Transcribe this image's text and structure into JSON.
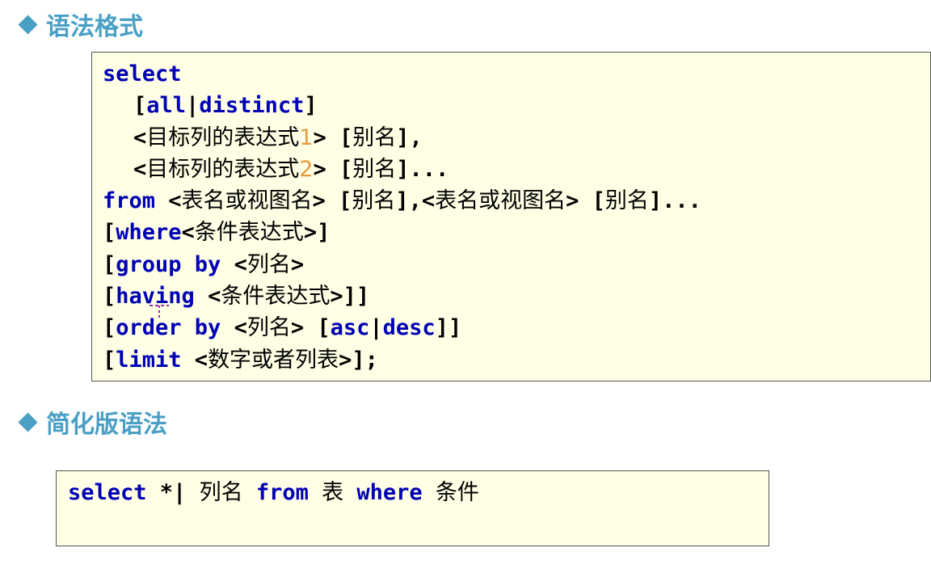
{
  "section1": {
    "title": "语法格式",
    "lines": [
      {
        "indent": false,
        "parts": [
          {
            "t": "k",
            "v": "select"
          }
        ]
      },
      {
        "indent": true,
        "parts": [
          {
            "t": "s",
            "v": "["
          },
          {
            "t": "k",
            "v": "all"
          },
          {
            "t": "s",
            "v": "|"
          },
          {
            "t": "k",
            "v": "distinct"
          },
          {
            "t": "s",
            "v": "]"
          }
        ]
      },
      {
        "indent": true,
        "parts": [
          {
            "t": "s",
            "v": "<"
          },
          {
            "t": "c",
            "v": "目标列的表达式"
          },
          {
            "t": "n",
            "v": "1"
          },
          {
            "t": "s",
            "v": "> ["
          },
          {
            "t": "c",
            "v": "别名"
          },
          {
            "t": "s",
            "v": "],"
          }
        ]
      },
      {
        "indent": true,
        "parts": [
          {
            "t": "s",
            "v": "<"
          },
          {
            "t": "c",
            "v": "目标列的表达式"
          },
          {
            "t": "n",
            "v": "2"
          },
          {
            "t": "s",
            "v": "> ["
          },
          {
            "t": "c",
            "v": "别名"
          },
          {
            "t": "s",
            "v": "]..."
          }
        ]
      },
      {
        "indent": false,
        "parts": [
          {
            "t": "k",
            "v": "from"
          },
          {
            "t": "s",
            "v": " <"
          },
          {
            "t": "c",
            "v": "表名或视图名"
          },
          {
            "t": "s",
            "v": "> ["
          },
          {
            "t": "c",
            "v": "别名"
          },
          {
            "t": "s",
            "v": "],<"
          },
          {
            "t": "c",
            "v": "表名或视图名"
          },
          {
            "t": "s",
            "v": "> ["
          },
          {
            "t": "c",
            "v": "别名"
          },
          {
            "t": "s",
            "v": "]..."
          }
        ]
      },
      {
        "indent": false,
        "parts": [
          {
            "t": "s",
            "v": "["
          },
          {
            "t": "k",
            "v": "where"
          },
          {
            "t": "s",
            "v": "<"
          },
          {
            "t": "c",
            "v": "条件表达式"
          },
          {
            "t": "s",
            "v": ">]"
          }
        ]
      },
      {
        "indent": false,
        "parts": [
          {
            "t": "s",
            "v": "["
          },
          {
            "t": "k",
            "v": "group by"
          },
          {
            "t": "s",
            "v": " <"
          },
          {
            "t": "c",
            "v": "列名"
          },
          {
            "t": "s",
            "v": ">"
          }
        ]
      },
      {
        "indent": false,
        "parts": [
          {
            "t": "s",
            "v": "["
          },
          {
            "t": "k",
            "v": "having"
          },
          {
            "t": "s",
            "v": " <"
          },
          {
            "t": "c",
            "v": "条件表达式"
          },
          {
            "t": "s",
            "v": ">]]"
          }
        ]
      },
      {
        "indent": false,
        "parts": [
          {
            "t": "s",
            "v": "["
          },
          {
            "t": "k",
            "v": "order by"
          },
          {
            "t": "s",
            "v": " <"
          },
          {
            "t": "c",
            "v": "列名"
          },
          {
            "t": "s",
            "v": "> ["
          },
          {
            "t": "k",
            "v": "asc"
          },
          {
            "t": "s",
            "v": "|"
          },
          {
            "t": "k",
            "v": "desc"
          },
          {
            "t": "s",
            "v": "]]"
          }
        ]
      },
      {
        "indent": false,
        "parts": [
          {
            "t": "s",
            "v": "["
          },
          {
            "t": "k",
            "v": "limit"
          },
          {
            "t": "s",
            "v": " <"
          },
          {
            "t": "c",
            "v": "数字或者列表"
          },
          {
            "t": "s",
            "v": ">];"
          }
        ]
      }
    ]
  },
  "section2": {
    "title": "简化版语法",
    "parts": [
      {
        "t": "k",
        "v": "select"
      },
      {
        "t": "s",
        "v": " *| "
      },
      {
        "t": "c",
        "v": "列名"
      },
      {
        "t": "k",
        "v": " from "
      },
      {
        "t": "c",
        "v": "表"
      },
      {
        "t": "k",
        "v": " where "
      },
      {
        "t": "c",
        "v": "条件"
      }
    ]
  },
  "colors": {
    "heading": "#4aa0c4",
    "keyword": "#0000b4",
    "number": "#e89a3c",
    "box_bg": "#ffffe6",
    "cursor": "#9b2fa6"
  },
  "icons": {
    "bullet": "diamond-bullet-icon",
    "pointer": "text-cursor-icon"
  }
}
